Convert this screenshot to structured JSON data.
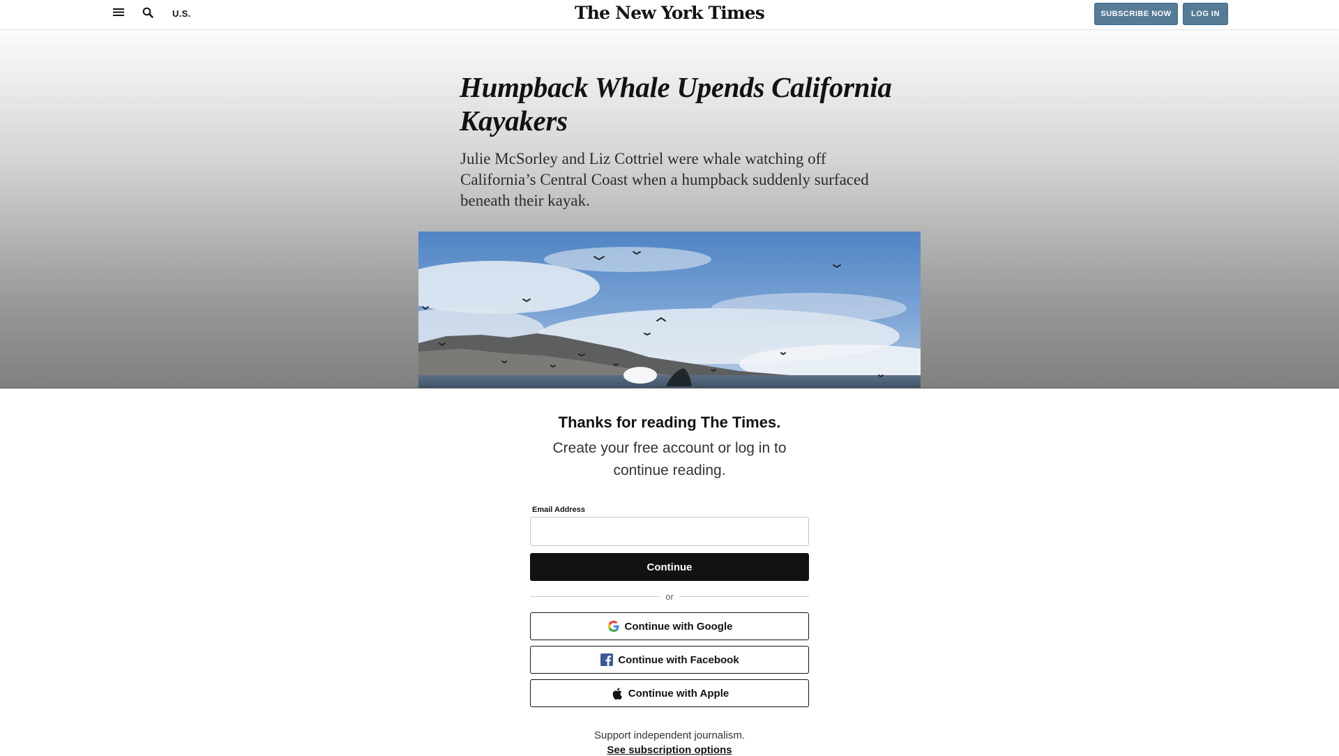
{
  "header": {
    "section_label": "U.S.",
    "masthead": "The New York Times",
    "subscribe_label": "SUBSCRIBE NOW",
    "login_label": "LOG IN",
    "icons": [
      "menu-icon",
      "search-icon"
    ],
    "accent_color": "#567b95"
  },
  "article": {
    "headline": "Humpback Whale Upends California Kayakers",
    "summary": "Julie McSorley and Liz Cottriel were whale watching off California’s Central Coast when a humpback suddenly surfaced beneath their kayak.",
    "media": "video still of a humpback whale surfacing near kayakers with birds overhead"
  },
  "regwall": {
    "title": "Thanks for reading The Times.",
    "subtitle": "Create your free account or log in to continue reading.",
    "email_label": "Email Address",
    "email_value": "",
    "continue_label": "Continue",
    "divider_text": "or",
    "google_label": "Continue with Google",
    "facebook_label": "Continue with Facebook",
    "apple_label": "Continue with Apple",
    "support_text": "Support independent journalism.",
    "subscription_link": "See subscription options"
  }
}
